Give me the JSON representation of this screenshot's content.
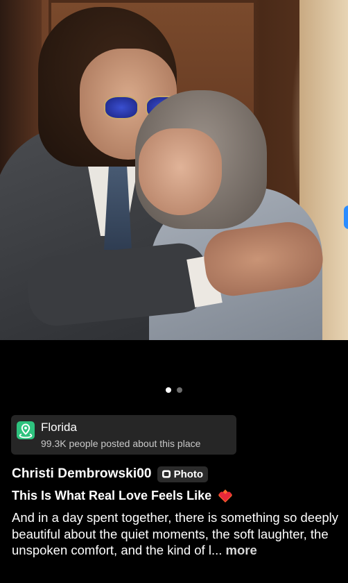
{
  "carousel": {
    "total": 2,
    "active_index": 0
  },
  "location": {
    "name": "Florida",
    "subtitle": "99.3K people posted about this place",
    "icon": "map-pin-icon",
    "icon_color": "#2ec27e"
  },
  "post": {
    "author": "Christi Dembrowski00",
    "type_badge": "Photo",
    "title": "This Is What Real Love Feels Like",
    "title_emoji": "heart-on-fire-icon",
    "description": "And in a day spent together, there is something so deeply beautiful about the quiet moments, the soft laughter, the unspoken comfort, and the kind of l...",
    "more_label": "more"
  },
  "colors": {
    "background": "#000000",
    "card": "#262626",
    "accent_edge": "#2a8cff"
  }
}
